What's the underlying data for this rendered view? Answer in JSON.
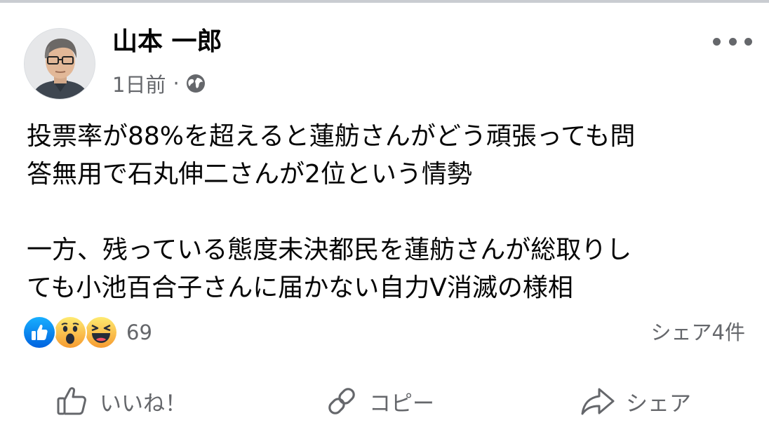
{
  "post": {
    "author": "山本 一郎",
    "time": "1日前",
    "separator": "·",
    "privacy_icon": "globe-icon",
    "lines": [
      "投票率が88%を超えると蓮舫さんがどう頑張っても問",
      "答無用で石丸伸二さんが2位という情勢",
      "",
      "一方、残っている態度未決都民を蓮舫さんが総取りし",
      "ても小池百合子さんに届かない自力V消滅の様相"
    ]
  },
  "reactions": {
    "icons": [
      "like-reaction-icon",
      "wow-reaction-icon",
      "haha-reaction-icon"
    ],
    "count": "69",
    "shares": "シェア4件"
  },
  "actions": {
    "like": "いいね！",
    "copy": "コピー",
    "share": "シェア"
  },
  "colors": {
    "text": "#050505",
    "secondary": "#65676b",
    "like_blue": "#1877f2",
    "emoji_yellow": "#f7b125"
  }
}
